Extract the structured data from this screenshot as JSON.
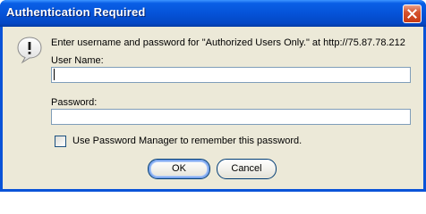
{
  "window": {
    "title": "Authentication Required"
  },
  "dialog": {
    "prompt": "Enter username and password for \"Authorized Users Only.\" at http://75.87.78.212",
    "username_label": "User Name:",
    "username_value": "",
    "password_label": "Password:",
    "password_value": "",
    "remember_label": "Use Password Manager to remember this password.",
    "remember_checked": false
  },
  "buttons": {
    "ok_label": "OK",
    "cancel_label": "Cancel"
  },
  "icons": {
    "dialog_icon": "warning-bubble-icon",
    "close_icon": "close-icon"
  },
  "colors": {
    "titlebar": "#0553d8",
    "close_button": "#d5532e",
    "dialog_background": "#ece9d8",
    "field_border": "#7f9db9"
  }
}
